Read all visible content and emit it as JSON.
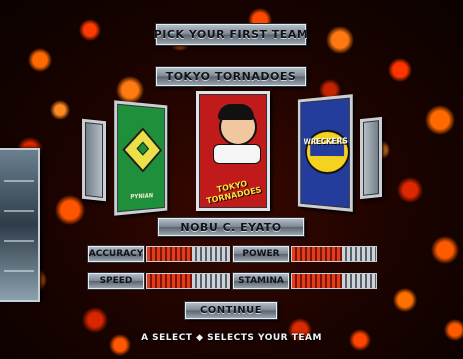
{
  "screen": {
    "title": "PICK YOUR FIRST TEAM",
    "team_name": "TOKYO TORNADOES",
    "player_name": "NOBU C. EYATO",
    "continue_label": "CONTINUE",
    "hint": "A SELECT ◆ SELECTS YOUR TEAM"
  },
  "team_cards": [
    {
      "position": "far-left",
      "color": "#7d8895"
    },
    {
      "position": "left",
      "label": "PYNIAN",
      "color": "#1e8f3a"
    },
    {
      "position": "center-selected",
      "label": "TOKYO TORNADOES",
      "color": "#c01a1a"
    },
    {
      "position": "right",
      "label": "WRECKERS",
      "color": "#243c9c"
    },
    {
      "position": "far-right",
      "color": "#7d8895"
    }
  ],
  "stats": {
    "accuracy": {
      "label": "ACCURACY",
      "value_fraction": 0.55
    },
    "power": {
      "label": "POWER",
      "value_fraction": 0.6
    },
    "speed": {
      "label": "SPEED",
      "value_fraction": 0.55
    },
    "stamina": {
      "label": "STAMINA",
      "value_fraction": 0.6
    }
  },
  "colors": {
    "plate_metal": "#7d8895",
    "bar_fill": "#e23c1a",
    "background_fire": "#ff5500"
  }
}
